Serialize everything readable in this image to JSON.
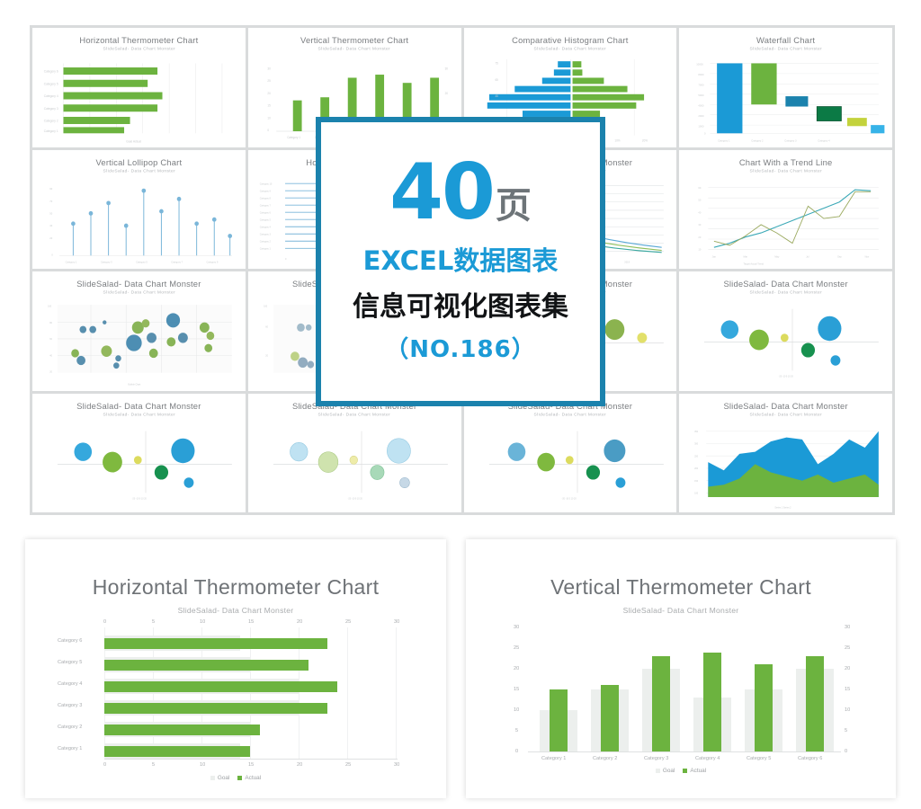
{
  "badge": {
    "number": "40",
    "unit": "页",
    "line2": "EXCEL数据图表",
    "line3": "信息可视化图表集",
    "line4": "（NO.186）",
    "accent_blue": "#1b9ad6",
    "border_blue": "#1b82ad",
    "gray": "#6d7478"
  },
  "grid": {
    "subtitle": "SlideSalad- Data Chart Monster",
    "thumbs": [
      {
        "title": "Horizontal Thermometer Chart",
        "kind": "hbar"
      },
      {
        "title": "Vertical Thermometer Chart",
        "kind": "vbar"
      },
      {
        "title": "Comparative Histogram Chart",
        "kind": "tornado"
      },
      {
        "title": "Waterfall Chart",
        "kind": "waterfall"
      },
      {
        "title": "Vertical Lollipop Chart",
        "kind": "lollipop-v"
      },
      {
        "title": "Horizontal Lollipop Chart",
        "kind": "lollipop-h"
      },
      {
        "title": "SlideSalad- Data Chart Monster",
        "kind": "decay-lines"
      },
      {
        "title": "Chart With a Trend Line",
        "kind": "trendline"
      },
      {
        "title": "SlideSalad- Data Chart Monster",
        "kind": "bubble-many"
      },
      {
        "title": "SlideSalad- Data Chart Monster",
        "kind": "bubble-many"
      },
      {
        "title": "SlideSalad- Data Chart Monster",
        "kind": "bubble-quad"
      },
      {
        "title": "SlideSalad- Data Chart Monster",
        "kind": "bubble-quad"
      },
      {
        "title": "SlideSalad- Data Chart Monster",
        "kind": "bubble-quad"
      },
      {
        "title": "SlideSalad- Data Chart Monster",
        "kind": "bubble-quad"
      },
      {
        "title": "SlideSalad- Data Chart Monster",
        "kind": "bubble-quad"
      },
      {
        "title": "SlideSalad- Data Chart Monster",
        "kind": "area-stacked"
      }
    ]
  },
  "chart_data": [
    {
      "type": "bar",
      "orientation": "horizontal",
      "title": "Horizontal Thermometer Chart",
      "subtitle": "SlideSalad- Data Chart Monster",
      "categories": [
        "Category 1",
        "Category 2",
        "Category 3",
        "Category 4",
        "Category 5",
        "Category 6"
      ],
      "series": [
        {
          "name": "Goal",
          "color": "#ecefed",
          "values": [
            14,
            15,
            20,
            20,
            20,
            20
          ]
        },
        {
          "name": "Actual",
          "color": "#6cb33f",
          "values": [
            15,
            16,
            23,
            24,
            21,
            23
          ]
        }
      ],
      "xlabel": "",
      "ylabel": "",
      "xlim": [
        0,
        30
      ],
      "xticks": [
        "0",
        "5",
        "10",
        "15",
        "20",
        "25",
        "30"
      ],
      "legend": [
        "Goal",
        "Actual"
      ],
      "legend_position": "bottom",
      "grid": true,
      "axis_top_and_bottom": true
    },
    {
      "type": "bar",
      "orientation": "vertical",
      "title": "Vertical Thermometer Chart",
      "subtitle": "SlideSalad- Data Chart Monster",
      "categories": [
        "Category 1",
        "Category 2",
        "Category 3",
        "Category 4",
        "Category 5",
        "Category 6"
      ],
      "series": [
        {
          "name": "Goal",
          "color": "#ecefed",
          "values": [
            10,
            15,
            20,
            13,
            15,
            20
          ]
        },
        {
          "name": "Actual",
          "color": "#6cb33f",
          "values": [
            15,
            16,
            23,
            24,
            21,
            23
          ]
        }
      ],
      "xlabel": "",
      "ylabel": "",
      "ylim": [
        0,
        30
      ],
      "yticks": [
        "0",
        "5",
        "10",
        "15",
        "20",
        "25",
        "30"
      ],
      "dual_axis": true,
      "legend": [
        "Goal",
        "Actual"
      ],
      "legend_position": "bottom",
      "grid": false
    }
  ]
}
